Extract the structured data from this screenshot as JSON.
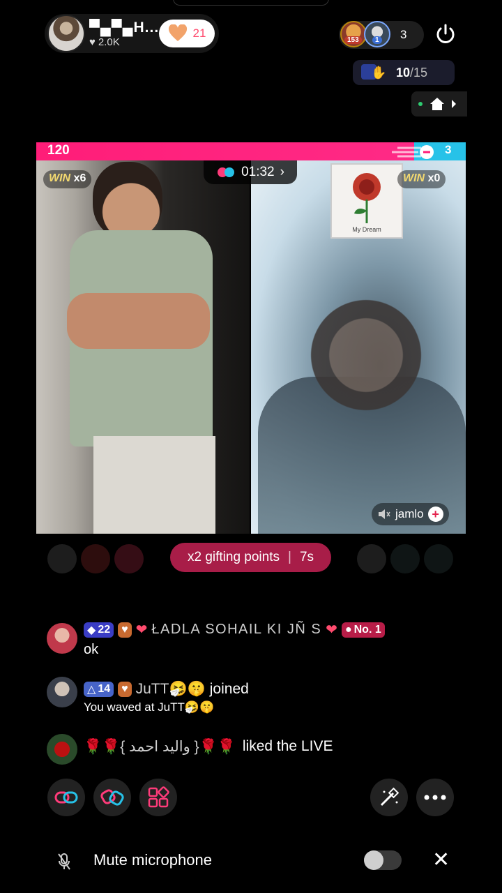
{
  "host": {
    "name": "▀▄▀▄H...",
    "likes": "2.0K",
    "heart_count": "21"
  },
  "viewers": {
    "badge1": "153",
    "badge2": "1",
    "count": "3"
  },
  "rank": {
    "current": "10",
    "total": "/15"
  },
  "battle": {
    "score_left": "120",
    "score_right": "3",
    "timer": "01:32",
    "left_win": {
      "label": "WIN",
      "mult": "x6"
    },
    "right_win": {
      "label": "WIN",
      "mult": "x0"
    },
    "gift_card_label": "My Dream",
    "opponent_name": "jamlo"
  },
  "gifting": {
    "text": "x2 gifting points",
    "seconds": "7s"
  },
  "chat": [
    {
      "level": "22",
      "name": "ŁADLA  SOHAIL  KI  JÑ S",
      "rank_badge": "No. 1",
      "message": "ok"
    },
    {
      "level": "14",
      "name": "JuTT🤧🤫",
      "action": "joined",
      "sub": "You waved at JuTT🤧🤫"
    },
    {
      "name": "🌹🌹{ واليد احمد }🌹🌹",
      "action": "liked the LIVE"
    }
  ],
  "bottom": {
    "mute_label": "Mute microphone"
  },
  "colors": {
    "accent": "#ff1d78",
    "blue": "#27c2e8",
    "gift_pill": "#a81d48"
  }
}
